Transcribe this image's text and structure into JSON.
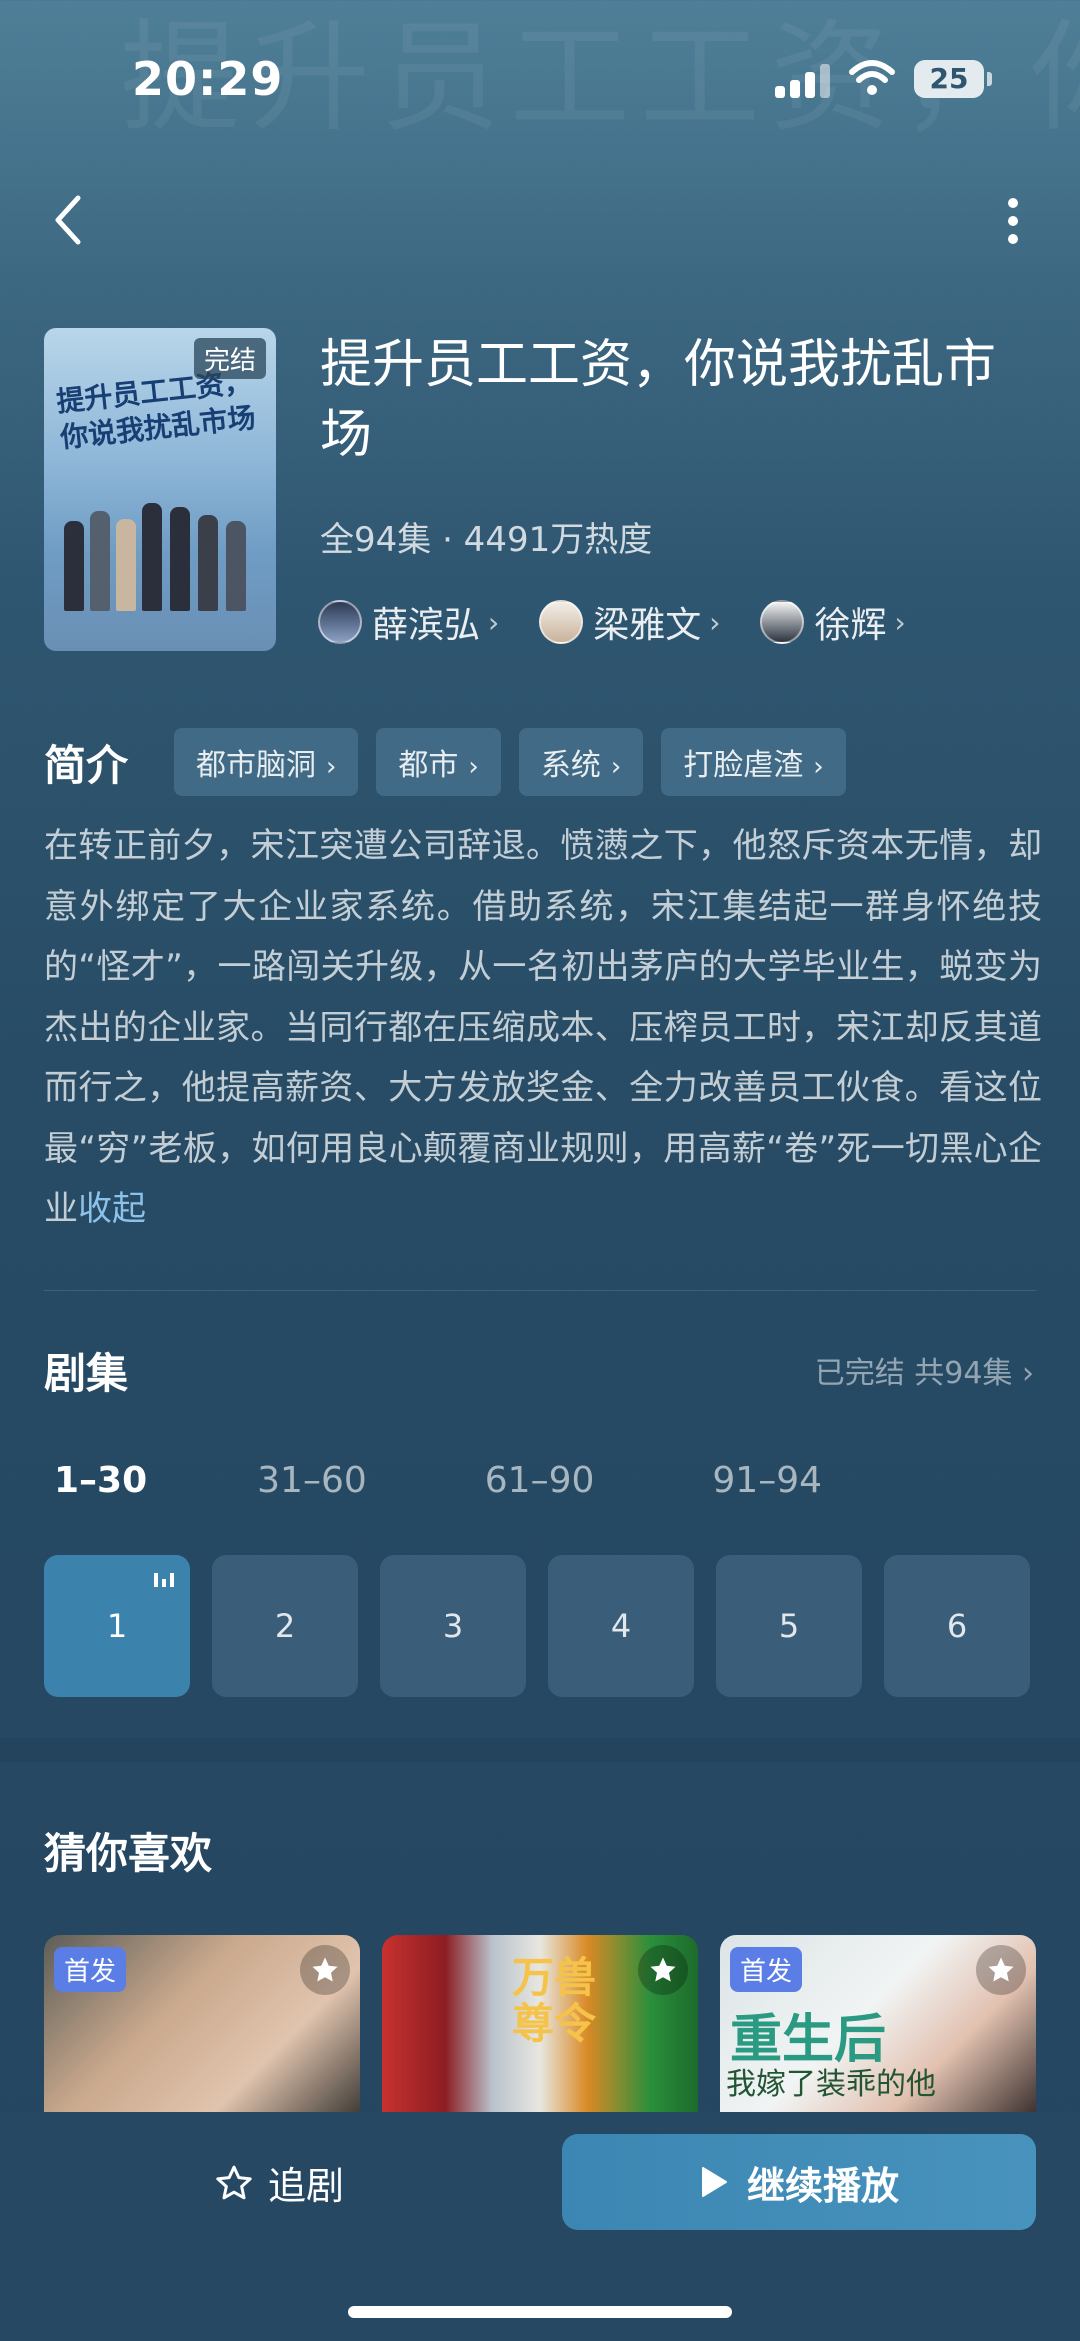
{
  "status_bar": {
    "time": "20:29",
    "battery": "25"
  },
  "show": {
    "title": "提升员工工资，你说我扰乱市场",
    "poster_badge": "完结",
    "poster_text": "提升员工工资，你说我扰乱市场",
    "meta": "全94集 · 4491万热度",
    "cast": [
      {
        "name": "薛滨弘"
      },
      {
        "name": "梁雅文"
      },
      {
        "name": "徐辉"
      }
    ]
  },
  "intro": {
    "label": "简介",
    "tags": [
      "都市脑洞",
      "都市",
      "系统",
      "打脸虐渣"
    ],
    "synopsis": "在转正前夕，宋江突遭公司辞退。愤懑之下，他怒斥资本无情，却意外绑定了大企业家系统。借助系统，宋江集结起一群身怀绝技的“怪才”，一路闯关升级，从一名初出茅庐的大学毕业生，蜕变为杰出的企业家。当同行都在压缩成本、压榨员工时，宋江却反其道而行之，他提高薪资、大方发放奖金、全力改善员工伙食。看这位最“穷”老板，如何用良心颠覆商业规则，用高薪“卷”死一切黑心企业",
    "collapse": "收起"
  },
  "episodes": {
    "label": "剧集",
    "status": "已完结 共94集",
    "ranges": [
      "1–30",
      "31–60",
      "61–90",
      "91–94"
    ],
    "items": [
      "1",
      "2",
      "3",
      "4",
      "5",
      "6"
    ]
  },
  "recommend": {
    "label": "猜你喜欢",
    "cards": [
      {
        "badge": "首发"
      },
      {
        "text": "万兽尊令"
      },
      {
        "badge": "首发",
        "text": "重生后",
        "sub": "我嫁了装乖的他"
      }
    ]
  },
  "bottom": {
    "follow_label": "追剧",
    "play_label": "继续播放"
  },
  "colors": {
    "accent": "#3b83ad",
    "background": "#264862",
    "link": "#8cc1e8"
  }
}
